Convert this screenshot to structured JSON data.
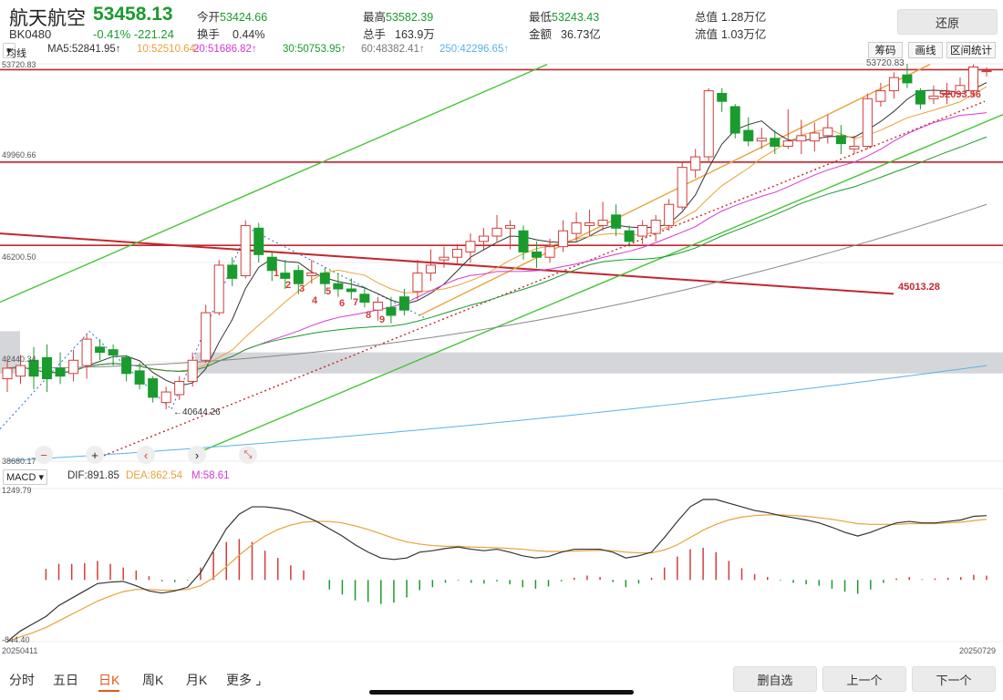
{
  "header": {
    "name": "航天航空",
    "code": "BK0480",
    "price": "53458.13",
    "change": "-0.41% -221.24",
    "restore_label": "还原"
  },
  "stats": [
    {
      "label": "今开",
      "value": "53424.66",
      "color": "#1a9b2e"
    },
    {
      "label": "换手",
      "value": "0.44%",
      "color": "#333"
    },
    {
      "label": "最高",
      "value": "53582.39",
      "color": "#1a9b2e"
    },
    {
      "label": "总手",
      "value": "163.9万",
      "color": "#333"
    },
    {
      "label": "最低",
      "value": "53243.43",
      "color": "#1a9b2e"
    },
    {
      "label": "金额",
      "value": "36.73亿",
      "color": "#333"
    },
    {
      "label": "总值",
      "value": "1.28万亿",
      "color": "#333"
    },
    {
      "label": "流值",
      "value": "1.03万亿",
      "color": "#333"
    }
  ],
  "ma_bar": {
    "selector": "均线",
    "items": [
      {
        "text": "MA5:52841.95↑",
        "color": "#333"
      },
      {
        "text": "10:52510.64↑",
        "color": "#e8a23c"
      },
      {
        "text": "20:51686.82↑",
        "color": "#d43ad4"
      },
      {
        "text": "30:50753.95↑",
        "color": "#1a9b2e"
      },
      {
        "text": "60:48382.41↑",
        "color": "#777"
      },
      {
        "text": "250:42296.65↑",
        "color": "#5ab2e8"
      }
    ]
  },
  "tools": {
    "chip": "筹码",
    "draw": "画线",
    "range": "区间统计"
  },
  "y_labels": [
    "53720.83",
    "49960.66",
    "46200.50",
    "42440.34",
    "38680.17"
  ],
  "annotations": {
    "last_close": "53720.83",
    "right_label": "52093.56",
    "trend_label": "45013.28",
    "low_label": "←40644.26",
    "wave_points": [
      "1",
      "2",
      "3",
      "4",
      "5",
      "6",
      "7",
      "8",
      "9"
    ]
  },
  "macd_bar": {
    "selector": "MACD",
    "dif": "DIF:891.85",
    "dea": "DEA:862.54",
    "m": "M:58.61",
    "top": "1249.79",
    "bottom": "-844.40"
  },
  "dates": {
    "start": "20250411",
    "end": "20250729"
  },
  "tabs": [
    "分时",
    "五日",
    "日K",
    "周K",
    "月K",
    "更多"
  ],
  "footer": {
    "delete": "删自选",
    "prev": "上一个",
    "next": "下一个"
  },
  "chart_data": {
    "type": "candlestick",
    "y_range": [
      38680.17,
      53720.83
    ],
    "candles": [
      {
        "o": 41800,
        "c": 42200,
        "h": 42600,
        "l": 41300
      },
      {
        "o": 41900,
        "c": 42300,
        "h": 42700,
        "l": 41600
      },
      {
        "o": 42500,
        "c": 41900,
        "h": 43000,
        "l": 41400
      },
      {
        "o": 42600,
        "c": 41800,
        "h": 43100,
        "l": 41300
      },
      {
        "o": 42200,
        "c": 41900,
        "h": 42800,
        "l": 41600
      },
      {
        "o": 42000,
        "c": 42500,
        "h": 42900,
        "l": 41700
      },
      {
        "o": 42300,
        "c": 43300,
        "h": 43500,
        "l": 41800
      },
      {
        "o": 43000,
        "c": 42800,
        "h": 43300,
        "l": 42500
      },
      {
        "o": 42900,
        "c": 42700,
        "h": 43100,
        "l": 42300
      },
      {
        "o": 42600,
        "c": 42000,
        "h": 42700,
        "l": 41700
      },
      {
        "o": 42100,
        "c": 41600,
        "h": 42400,
        "l": 41400
      },
      {
        "o": 41800,
        "c": 41100,
        "h": 41900,
        "l": 40900
      },
      {
        "o": 40900,
        "c": 41300,
        "h": 41500,
        "l": 40644
      },
      {
        "o": 41200,
        "c": 41700,
        "h": 41900,
        "l": 41000
      },
      {
        "o": 41700,
        "c": 42500,
        "h": 42800,
        "l": 41500
      },
      {
        "o": 42500,
        "c": 44300,
        "h": 44600,
        "l": 42400
      },
      {
        "o": 44300,
        "c": 46100,
        "h": 46300,
        "l": 44200
      },
      {
        "o": 46100,
        "c": 45600,
        "h": 46400,
        "l": 45300
      },
      {
        "o": 45700,
        "c": 47600,
        "h": 47800,
        "l": 45600
      },
      {
        "o": 47500,
        "c": 46500,
        "h": 47700,
        "l": 46200
      },
      {
        "o": 46400,
        "c": 45900,
        "h": 46600,
        "l": 45500
      },
      {
        "o": 45800,
        "c": 45600,
        "h": 46300,
        "l": 45200
      },
      {
        "o": 45900,
        "c": 45400,
        "h": 46100,
        "l": 45000
      },
      {
        "o": 45700,
        "c": 45800,
        "h": 46300,
        "l": 45400
      },
      {
        "o": 45800,
        "c": 45400,
        "h": 46000,
        "l": 45000
      },
      {
        "o": 45400,
        "c": 45200,
        "h": 45800,
        "l": 44900
      },
      {
        "o": 45200,
        "c": 45100,
        "h": 45600,
        "l": 44800
      },
      {
        "o": 45000,
        "c": 44700,
        "h": 45300,
        "l": 44500
      },
      {
        "o": 44400,
        "c": 44700,
        "h": 44900,
        "l": 44000
      },
      {
        "o": 44500,
        "c": 44200,
        "h": 44900,
        "l": 43900
      },
      {
        "o": 44900,
        "c": 44400,
        "h": 45200,
        "l": 44200
      },
      {
        "o": 45100,
        "c": 45800,
        "h": 46300,
        "l": 44800
      },
      {
        "o": 45800,
        "c": 46100,
        "h": 46700,
        "l": 45500
      },
      {
        "o": 46300,
        "c": 46400,
        "h": 46800,
        "l": 46000
      },
      {
        "o": 46400,
        "c": 46700,
        "h": 46900,
        "l": 46100
      },
      {
        "o": 46600,
        "c": 47000,
        "h": 47300,
        "l": 46200
      },
      {
        "o": 47000,
        "c": 47200,
        "h": 47500,
        "l": 46700
      },
      {
        "o": 47200,
        "c": 47500,
        "h": 48000,
        "l": 47000
      },
      {
        "o": 47500,
        "c": 47600,
        "h": 47800,
        "l": 46700
      },
      {
        "o": 47400,
        "c": 46600,
        "h": 47600,
        "l": 46300
      },
      {
        "o": 46600,
        "c": 46400,
        "h": 47000,
        "l": 46000
      },
      {
        "o": 46400,
        "c": 46800,
        "h": 47100,
        "l": 46200
      },
      {
        "o": 46800,
        "c": 47400,
        "h": 47800,
        "l": 46600
      },
      {
        "o": 47300,
        "c": 47700,
        "h": 48100,
        "l": 47000
      },
      {
        "o": 47600,
        "c": 47700,
        "h": 48200,
        "l": 47200
      },
      {
        "o": 47600,
        "c": 47800,
        "h": 48500,
        "l": 47400
      },
      {
        "o": 48000,
        "c": 47500,
        "h": 48400,
        "l": 47200
      },
      {
        "o": 47400,
        "c": 47000,
        "h": 47600,
        "l": 46800
      },
      {
        "o": 47200,
        "c": 47600,
        "h": 47800,
        "l": 46900
      },
      {
        "o": 47300,
        "c": 47800,
        "h": 48000,
        "l": 47000
      },
      {
        "o": 47600,
        "c": 48400,
        "h": 48600,
        "l": 47400
      },
      {
        "o": 48300,
        "c": 49800,
        "h": 50000,
        "l": 48200
      },
      {
        "o": 49700,
        "c": 50200,
        "h": 50500,
        "l": 49400
      },
      {
        "o": 50200,
        "c": 52700,
        "h": 52800,
        "l": 50000
      },
      {
        "o": 52600,
        "c": 52300,
        "h": 52800,
        "l": 51900
      },
      {
        "o": 52100,
        "c": 51100,
        "h": 52200,
        "l": 50900
      },
      {
        "o": 51200,
        "c": 50800,
        "h": 51700,
        "l": 50600
      },
      {
        "o": 50800,
        "c": 50900,
        "h": 51300,
        "l": 50500
      },
      {
        "o": 50900,
        "c": 50600,
        "h": 51200,
        "l": 50300
      },
      {
        "o": 50600,
        "c": 50800,
        "h": 52000,
        "l": 50500
      },
      {
        "o": 50800,
        "c": 51000,
        "h": 51600,
        "l": 50300
      },
      {
        "o": 50800,
        "c": 51100,
        "h": 51500,
        "l": 50400
      },
      {
        "o": 51000,
        "c": 51300,
        "h": 51800,
        "l": 50700
      },
      {
        "o": 51000,
        "c": 50700,
        "h": 51400,
        "l": 50300
      },
      {
        "o": 50500,
        "c": 50600,
        "h": 51000,
        "l": 50300
      },
      {
        "o": 50600,
        "c": 52400,
        "h": 52600,
        "l": 50500
      },
      {
        "o": 52300,
        "c": 52700,
        "h": 53000,
        "l": 52100
      },
      {
        "o": 52700,
        "c": 53200,
        "h": 53400,
        "l": 52400
      },
      {
        "o": 53300,
        "c": 53000,
        "h": 53720,
        "l": 52800
      },
      {
        "o": 52700,
        "c": 52200,
        "h": 52800,
        "l": 52000
      },
      {
        "o": 52400,
        "c": 52500,
        "h": 52900,
        "l": 52200
      },
      {
        "o": 52600,
        "c": 52600,
        "h": 53000,
        "l": 52200
      },
      {
        "o": 52600,
        "c": 52900,
        "h": 53200,
        "l": 52500
      },
      {
        "o": 52700,
        "c": 53600,
        "h": 53700,
        "l": 52500
      },
      {
        "o": 53424,
        "c": 53458,
        "h": 53582,
        "l": 53243
      }
    ],
    "macd": {
      "range": [
        -844.4,
        1249.79
      ],
      "dif": [
        -844,
        -700,
        -600,
        -500,
        -350,
        -250,
        -150,
        -50,
        -30,
        -20,
        -80,
        -150,
        -180,
        -150,
        -100,
        100,
        400,
        700,
        900,
        1000,
        1000,
        980,
        950,
        880,
        800,
        700,
        600,
        480,
        380,
        300,
        280,
        300,
        380,
        400,
        430,
        450,
        420,
        400,
        420,
        380,
        330,
        300,
        320,
        380,
        420,
        420,
        420,
        380,
        300,
        330,
        380,
        580,
        800,
        1000,
        1100,
        1100,
        1050,
        1000,
        950,
        920,
        880,
        850,
        820,
        780,
        720,
        650,
        600,
        650,
        720,
        780,
        800,
        780,
        780,
        800,
        820,
        870,
        880
      ],
      "dea": [
        -844,
        -780,
        -720,
        -650,
        -560,
        -470,
        -380,
        -290,
        -220,
        -160,
        -130,
        -130,
        -140,
        -140,
        -130,
        -80,
        30,
        180,
        340,
        480,
        600,
        690,
        750,
        790,
        800,
        800,
        780,
        740,
        690,
        630,
        570,
        520,
        490,
        470,
        460,
        460,
        450,
        445,
        440,
        430,
        420,
        400,
        390,
        390,
        395,
        400,
        405,
        400,
        380,
        370,
        370,
        410,
        480,
        580,
        680,
        760,
        820,
        860,
        880,
        890,
        890,
        880,
        870,
        850,
        830,
        800,
        770,
        760,
        760,
        760,
        770,
        770,
        770,
        780,
        790,
        810,
        830
      ],
      "m": [
        0,
        0,
        0,
        150,
        220,
        220,
        230,
        260,
        220,
        170,
        130,
        50,
        -20,
        -30,
        -10,
        170,
        380,
        520,
        560,
        520,
        400,
        300,
        200,
        130,
        0,
        -130,
        -200,
        -280,
        -300,
        -330,
        -310,
        -240,
        -140,
        -100,
        -40,
        -10,
        -40,
        -50,
        -20,
        -60,
        -100,
        -120,
        -90,
        -20,
        30,
        60,
        40,
        -30,
        -100,
        -50,
        30,
        170,
        320,
        420,
        440,
        380,
        260,
        160,
        80,
        40,
        -10,
        -40,
        -60,
        -80,
        -120,
        -160,
        -190,
        -130,
        -40,
        20,
        40,
        10,
        20,
        30,
        40,
        70,
        58.61
      ]
    }
  }
}
